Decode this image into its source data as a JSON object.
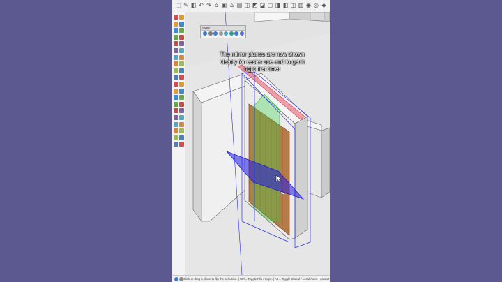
{
  "panel": {
    "title": "Styles"
  },
  "caption": {
    "text": "The mirror planes are now shown clearly for easier use and to get it right first time!"
  },
  "status_bar": {
    "text": "Click or drag a plane to flip the selection. | Ctrl = Toggle Flip / Copy. | Alt = Toggle Global / Local Axes. | Arrow Keys"
  },
  "colors": {
    "background": "#5c5991",
    "mirror_plane_blue": "#1f1ae6",
    "mirror_plane_green": "#39d34a",
    "mirror_plane_red": "#e25a6a",
    "door_wood": "#b77b49"
  },
  "icons": {
    "top_toolbar": [
      "select-icon",
      "eraser-icon",
      "paint-icon",
      "undo-icon",
      "redo-icon",
      "home-icon",
      "box-icon",
      "house-icon",
      "warehouse-icon",
      "model-icon",
      "view-icon",
      "iso-icon",
      "top-icon",
      "front-icon",
      "right-icon",
      "back-icon",
      "left-icon",
      "style-icon",
      "camera-icon",
      "tag-icon"
    ],
    "left_palette": [
      "select-tool-icon",
      "eraser-tool-icon",
      "pencil-tool-icon",
      "line-tool-icon",
      "arc-tool-icon",
      "shape-tool-icon",
      "push-pull-tool-icon",
      "move-tool-icon",
      "rotate-tool-icon",
      "offset-tool-icon",
      "tape-tool-icon",
      "text-tool-icon",
      "axes-tool-icon",
      "paint-tool-icon",
      "orbit-tool-icon",
      "pan-tool-icon",
      "zoom-tool-icon",
      "walk-tool-icon",
      "section-tool-icon",
      "sandbox-tool-icon"
    ]
  }
}
